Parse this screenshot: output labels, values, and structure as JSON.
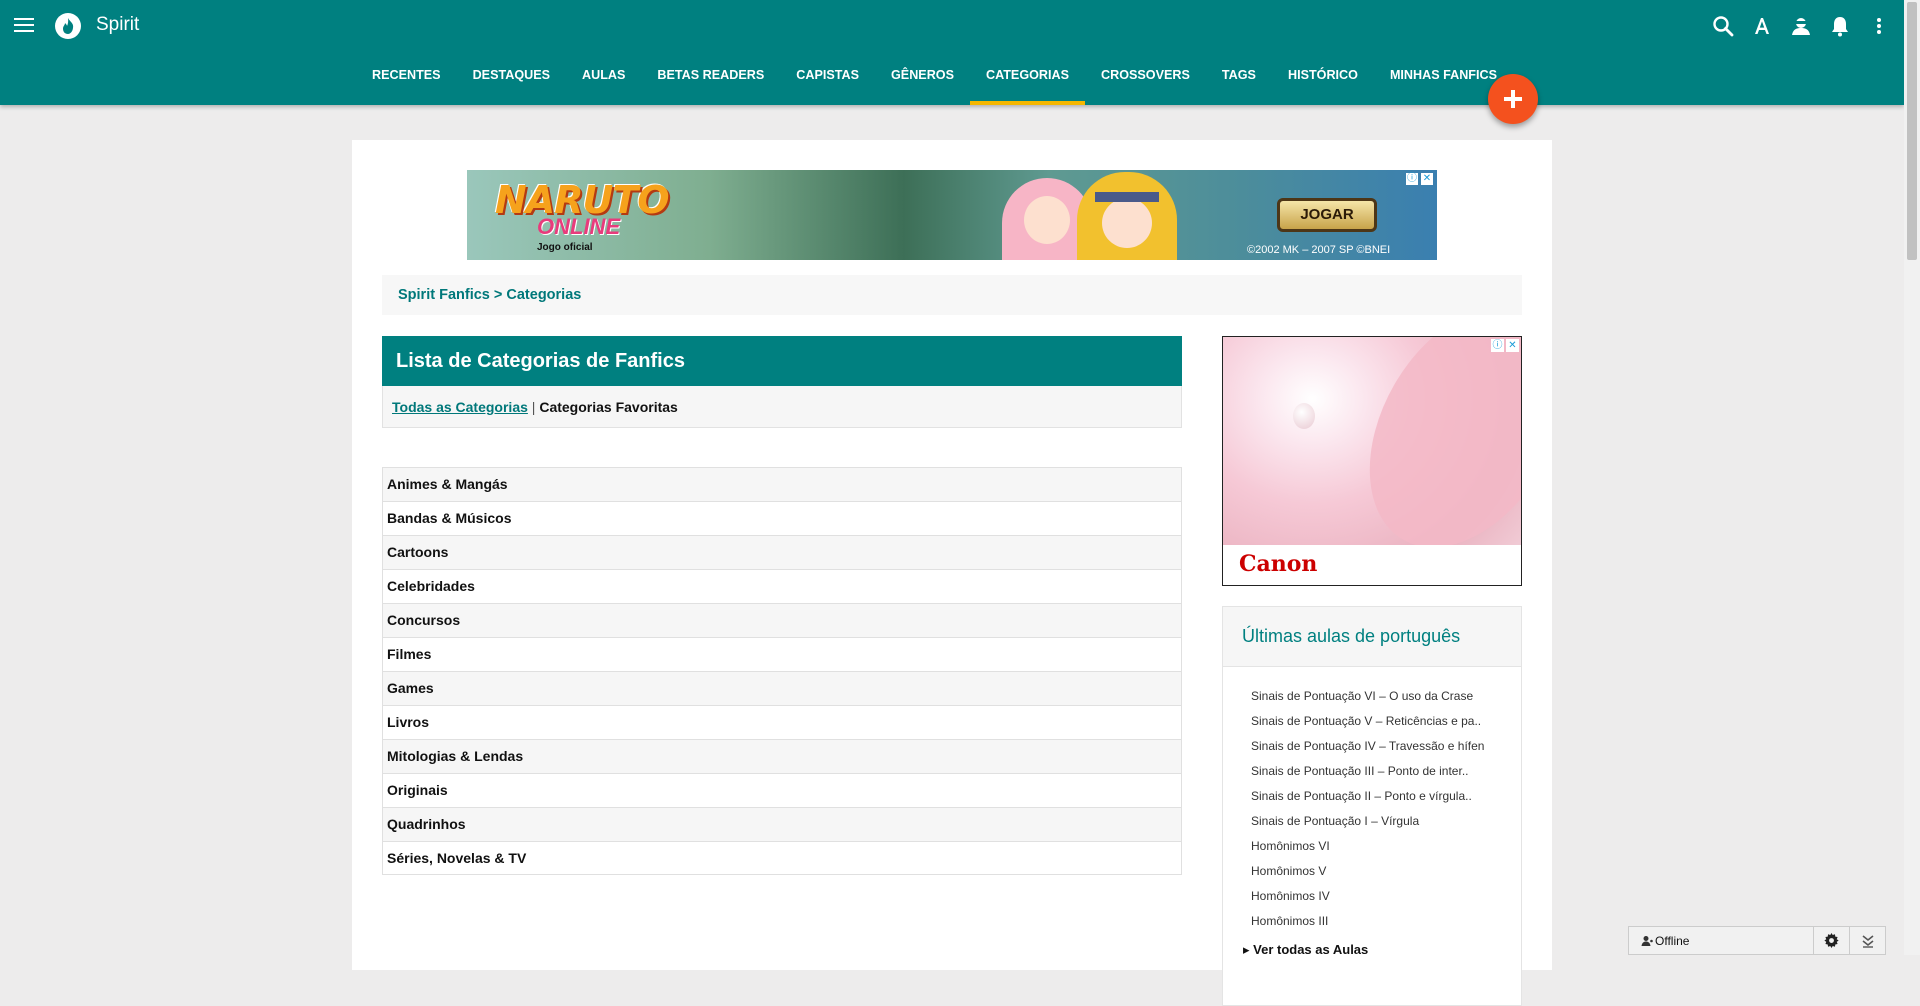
{
  "header": {
    "brand": "Spirit",
    "nav": [
      {
        "label": "RECENTES"
      },
      {
        "label": "DESTAQUES"
      },
      {
        "label": "AULAS"
      },
      {
        "label": "BETAS READERS"
      },
      {
        "label": "CAPISTAS"
      },
      {
        "label": "GÊNEROS"
      },
      {
        "label": "CATEGORIAS",
        "active": true
      },
      {
        "label": "CROSSOVERS"
      },
      {
        "label": "TAGS"
      },
      {
        "label": "HISTÓRICO"
      },
      {
        "label": "MINHAS FANFICS"
      }
    ],
    "icons": [
      "search-icon",
      "font-size-icon",
      "user-icon",
      "bell-icon",
      "more-vert-icon"
    ],
    "accent_color": "#008080",
    "active_underline_color": "#f5b700"
  },
  "ad_banner": {
    "logo": "NARUTO",
    "logo_sub": "ONLINE",
    "logo_caption": "Jogo oficial",
    "cta": "JOGAR",
    "copyright": "©2002 MK – 2007 SP    ©BNEI"
  },
  "breadcrumb": {
    "root": "Spirit Fanfics",
    "separator": " > ",
    "current": "Categorias"
  },
  "list": {
    "title": "Lista de Categorias de Fanfics",
    "filter_all": "Todas as Categorias",
    "filter_sep": " | ",
    "filter_fav": "Categorias Favoritas",
    "items": [
      "Animes & Mangás",
      "Bandas & Músicos",
      "Cartoons",
      "Celebridades",
      "Concursos",
      "Filmes",
      "Games",
      "Livros",
      "Mitologias & Lendas",
      "Originais",
      "Quadrinhos",
      "Séries, Novelas & TV"
    ]
  },
  "side_ad": {
    "brand": "Canon"
  },
  "aulas": {
    "title": "Últimas aulas de português",
    "items": [
      "Sinais de Pontuação VI – O uso da Crase",
      "Sinais de Pontuação V – Reticências e pa..",
      "Sinais de Pontuação IV – Travessão e hífen",
      "Sinais de Pontuação III – Ponto de inter..",
      "Sinais de Pontuação II – Ponto e vírgula..",
      "Sinais de Pontuação I – Vírgula",
      "Homônimos VI",
      "Homônimos V",
      "Homônimos IV",
      "Homônimos III"
    ],
    "see_all": "▸ Ver todas as Aulas"
  },
  "chat": {
    "status": "Offline"
  },
  "fab_color": "#f4511e"
}
